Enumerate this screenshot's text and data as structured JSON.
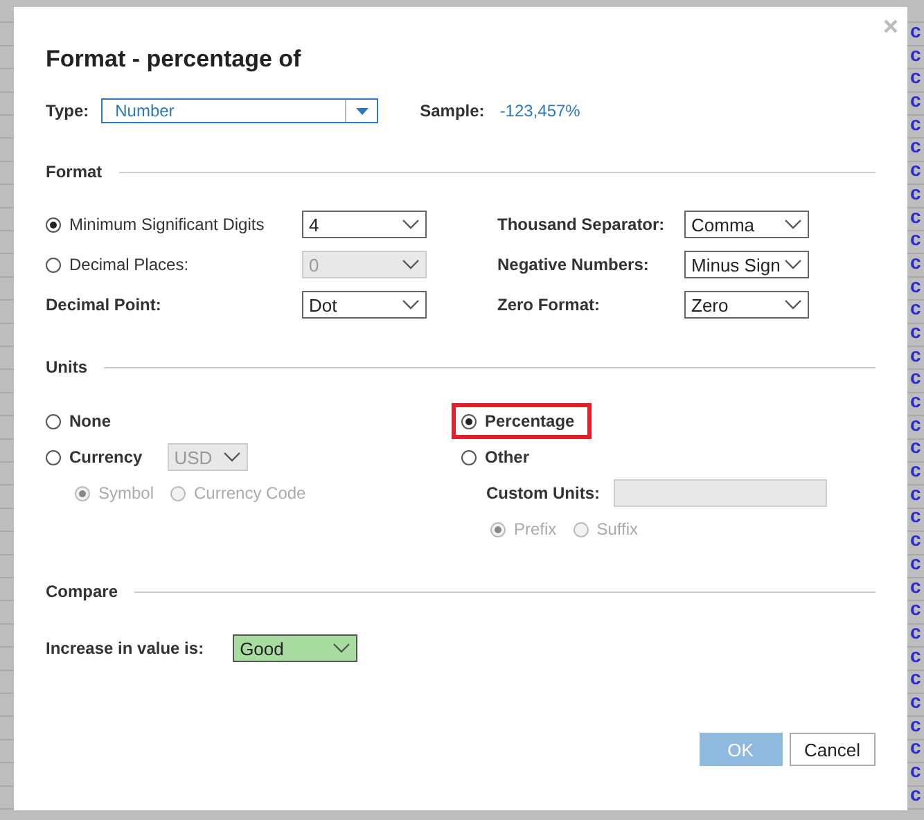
{
  "background": {
    "right_cells": [
      "c",
      "c",
      "c",
      "c",
      "c",
      "c",
      "c",
      "c",
      "c",
      "c",
      "c",
      "c",
      "c",
      "c",
      "c",
      "c",
      "c",
      "c",
      "c",
      "c",
      "c",
      "c",
      "c",
      "c",
      "c",
      "c",
      "c",
      "c",
      "c",
      "c",
      "c",
      "c",
      "c",
      "c"
    ]
  },
  "dialog": {
    "title": "Format - percentage of",
    "type_field": {
      "label": "Type:",
      "value": "Number"
    },
    "sample": {
      "label": "Sample:",
      "value": "-123,457%"
    },
    "format": {
      "heading": "Format",
      "digit_modes": [
        {
          "label": "Minimum Significant Digits",
          "selected": true,
          "select": {
            "value": "4",
            "disabled": false
          }
        },
        {
          "label": "Decimal Places:",
          "selected": false,
          "select": {
            "value": "0",
            "disabled": true
          }
        }
      ],
      "decimal_point": {
        "label": "Decimal Point:",
        "value": "Dot"
      },
      "right": [
        {
          "label": "Thousand Separator:",
          "value": "Comma"
        },
        {
          "label": "Negative Numbers:",
          "value": "Minus Sign"
        },
        {
          "label": "Zero Format:",
          "value": "Zero"
        }
      ]
    },
    "units": {
      "heading": "Units",
      "options": [
        {
          "label": "None",
          "selected": false,
          "highlighted": false
        },
        {
          "label": "Currency",
          "selected": false,
          "highlighted": false
        },
        {
          "label": "Percentage",
          "selected": true,
          "highlighted": true
        },
        {
          "label": "Other",
          "selected": false,
          "highlighted": false
        }
      ],
      "currency_select": {
        "value": "USD",
        "disabled": true
      },
      "currency_styles": [
        {
          "label": "Symbol",
          "selected": true,
          "disabled": true
        },
        {
          "label": "Currency Code",
          "selected": false,
          "disabled": true
        }
      ],
      "custom_units": {
        "label": "Custom Units:",
        "disabled": true
      },
      "affix": [
        {
          "label": "Prefix",
          "selected": true,
          "disabled": true
        },
        {
          "label": "Suffix",
          "selected": false,
          "disabled": true
        }
      ]
    },
    "compare": {
      "heading": "Compare",
      "label": "Increase in value is:",
      "value": "Good"
    },
    "buttons": [
      {
        "label": "OK",
        "disabled": true
      },
      {
        "label": "Cancel",
        "disabled": false
      }
    ]
  }
}
